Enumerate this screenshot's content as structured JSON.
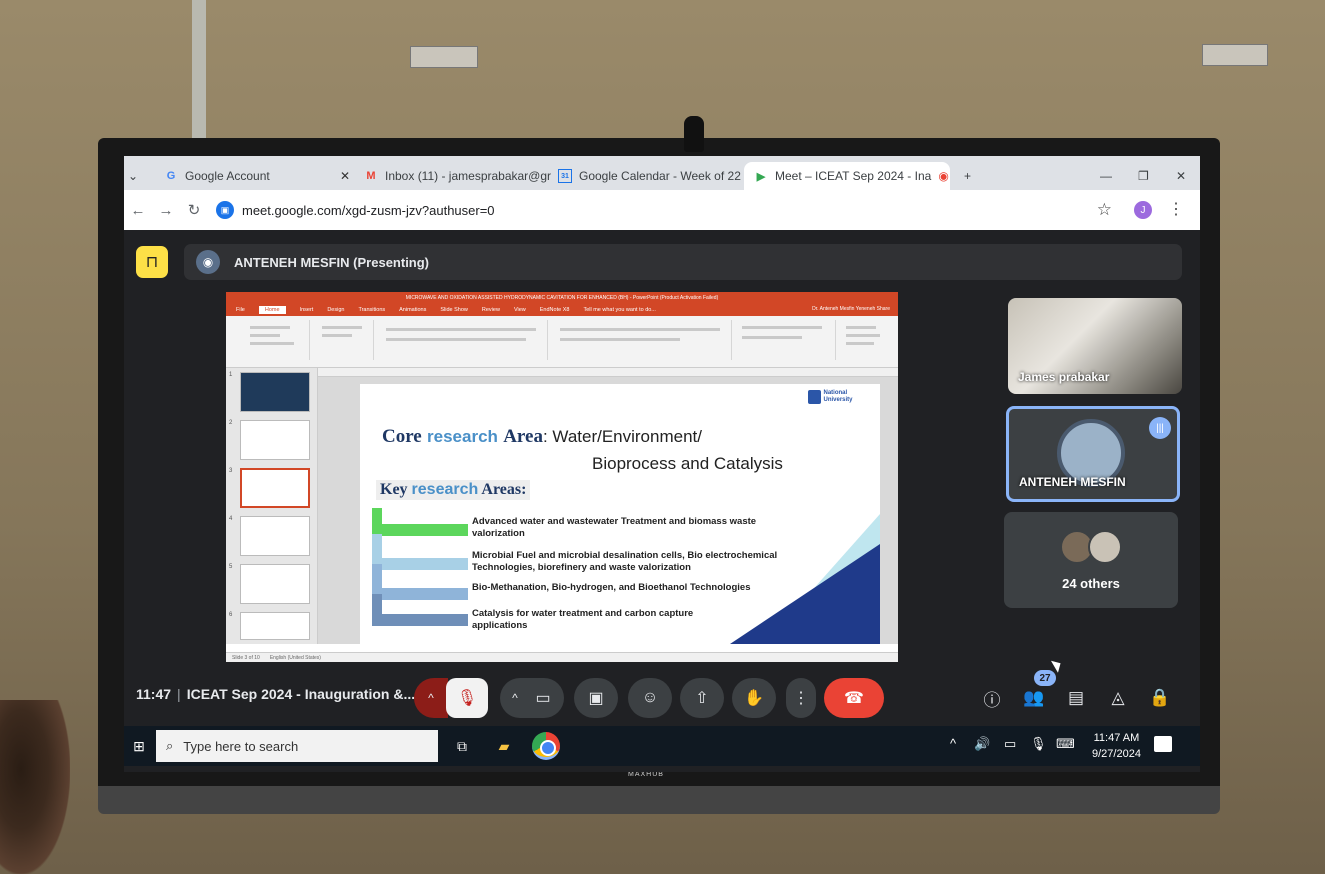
{
  "browser": {
    "tabs": [
      {
        "label": "Google Account",
        "icon": "google-icon"
      },
      {
        "label": "Inbox (11) - jamesprabakar@gr",
        "icon": "gmail-icon"
      },
      {
        "label": "Google Calendar - Week of 22 S",
        "icon": "calendar-icon"
      },
      {
        "label": "Meet – ICEAT Sep 2024 - Ina",
        "icon": "meet-icon"
      }
    ],
    "new_tab": "+",
    "url": "meet.google.com/xgd-zusm-jzv?authuser=0",
    "profile_initial": "J"
  },
  "meet": {
    "presenter_label": "ANTENEH MESFIN (Presenting)",
    "tiles": [
      {
        "label": "James prabakar"
      },
      {
        "label": "ANTENEH MESFIN"
      },
      {
        "label": "24 others"
      }
    ],
    "time": "11:47",
    "meeting_title": "ICEAT Sep 2024 - Inauguration &...",
    "participants_count": "27"
  },
  "slide": {
    "ppt_window_title": "MICROWAVE AND OXIDATION ASSISTED HYDRODYNAMIC CAVITATION FOR ENHANCED (BH) - PowerPoint (Product Activation Failed)",
    "menus": [
      "File",
      "Home",
      "Insert",
      "Design",
      "Transitions",
      "Animations",
      "Slide Show",
      "Review",
      "View",
      "EndNote X8",
      "Tell me what you want to do..."
    ],
    "ppt_user": "Dr. Anteneh Mesfin Yeneneh   Share",
    "logo_name": "National University",
    "core_prefix": "Core",
    "core_keyword": "research",
    "core_suffix_serif": "Area",
    "core_topic": ": Water/Environment/",
    "core_topic2": "Bioprocess and Catalysis",
    "key_prefix": "Key",
    "key_keyword": "research",
    "key_suffix": "Areas:",
    "items": [
      "Advanced water and wastewater Treatment and biomass waste valorization",
      "Microbial Fuel and microbial desalination  cells, Bio electrochemical Technologies, biorefinery and waste valorization",
      "Bio-Methanation, Bio-hydrogen, and Bioethanol Technologies",
      "Catalysis for water treatment and carbon capture applications"
    ],
    "status_left": "Slide 3 of 10",
    "status_lang": "English (United States)",
    "thumb_numbers": [
      "1",
      "2",
      "3",
      "4",
      "5",
      "6"
    ]
  },
  "taskbar": {
    "search_placeholder": "Type here to search",
    "time": "11:47 AM",
    "date": "9/27/2024"
  },
  "tv_brand": "MAXHUB",
  "colors": {
    "ppt_orange": "#d24726",
    "meet_bg": "#202124",
    "hangup_red": "#ea4335",
    "accent_blue": "#8ab4f8"
  }
}
